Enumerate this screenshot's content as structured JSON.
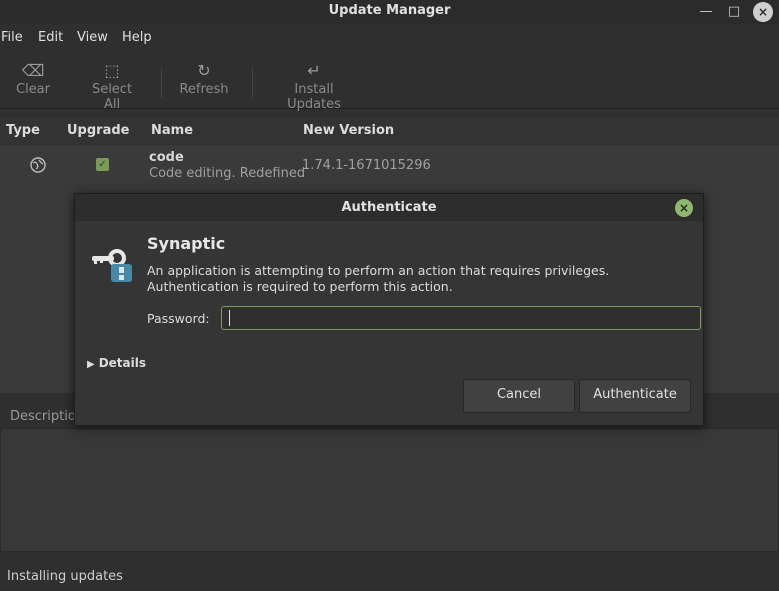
{
  "window": {
    "title": "Update Manager",
    "controls": {
      "minimize": "—",
      "maximize": "□",
      "close": "×"
    }
  },
  "menu": [
    "File",
    "Edit",
    "View",
    "Help"
  ],
  "toolbar": {
    "clear": "Clear",
    "select_all": "Select All",
    "refresh": "Refresh",
    "install": "Install Updates"
  },
  "columns": {
    "type": "Type",
    "upgrade": "Upgrade",
    "name": "Name",
    "version": "New Version"
  },
  "packages": [
    {
      "name": "code",
      "description": "Code editing. Redefined",
      "version": "1.74.1-1671015296",
      "checked": true
    }
  ],
  "description_tab": "Description",
  "status": "Installing updates",
  "dialog": {
    "title": "Authenticate",
    "app_name": "Synaptic",
    "message": "An application is attempting to perform an action that requires privileges. Authentication is required to perform this action.",
    "password_label": "Password:",
    "password_value": "",
    "details_label": "Details",
    "cancel_label": "Cancel",
    "authenticate_label": "Authenticate"
  },
  "colors": {
    "accent": "#8fb772",
    "checkbox": "#7a9a5a",
    "background": "#2f2f2f"
  }
}
